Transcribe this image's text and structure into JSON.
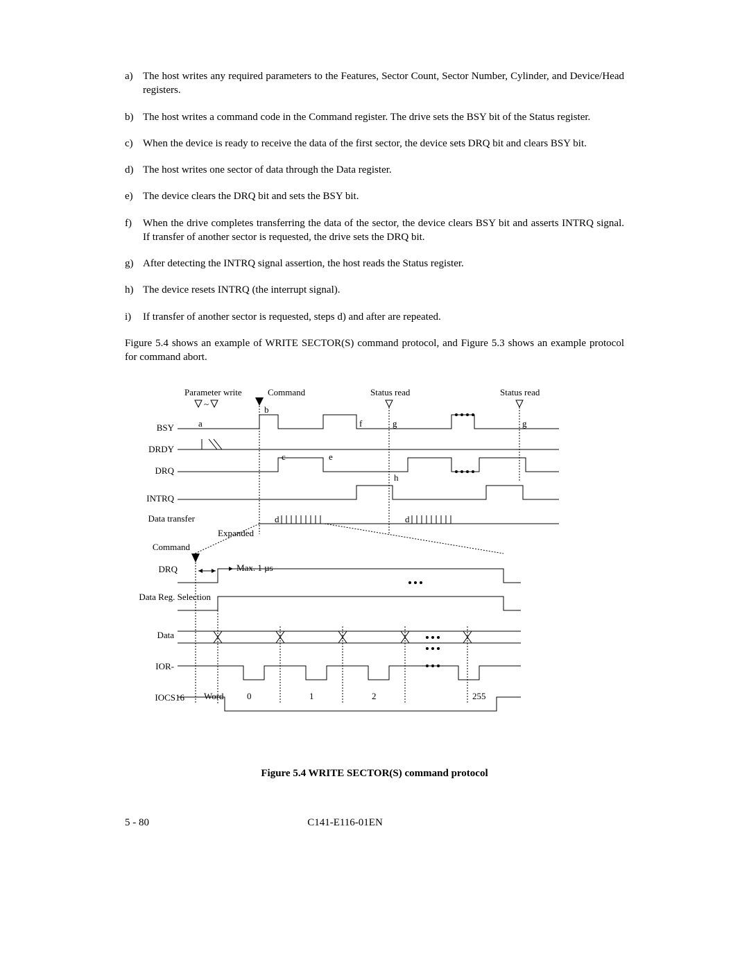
{
  "items": [
    {
      "m": "a)",
      "t": "The host writes any required parameters to the Features, Sector Count, Sector Number, Cylinder, and Device/Head registers."
    },
    {
      "m": "b)",
      "t": "The host writes a command code in the Command register. The drive sets the BSY bit of the Status register."
    },
    {
      "m": "c)",
      "t": "When the device is ready to receive the data of the first sector, the device sets DRQ bit and clears BSY bit."
    },
    {
      "m": "d)",
      "t": "The host writes one sector of data through the Data register."
    },
    {
      "m": "e)",
      "t": "The device clears the DRQ bit and sets the BSY bit."
    },
    {
      "m": "f)",
      "t": "When the drive completes transferring the data of the sector, the device clears BSY bit and asserts INTRQ signal.  If transfer of another sector is requested, the drive sets the DRQ bit."
    },
    {
      "m": "g)",
      "t": "After detecting the INTRQ signal assertion, the host reads the Status register."
    },
    {
      "m": "h)",
      "t": "The device resets INTRQ (the interrupt signal)."
    },
    {
      "m": "i)",
      "t": "If transfer of another sector is requested, steps d) and after are repeated."
    }
  ],
  "para": "Figure 5.4 shows an example of WRITE SECTOR(S) command protocol, and Figure 5.3 shows an example protocol for command abort.",
  "fig": {
    "top_labels": {
      "param": "Parameter write",
      "cmd": "Command",
      "sr1": "Status read",
      "sr2": "Status read"
    },
    "signals": [
      "BSY",
      "DRDY",
      "DRQ",
      "INTRQ",
      "Data transfer",
      "Command",
      "DRQ",
      "Data Reg. Selection",
      "Data",
      "IOR-",
      "IOCS16"
    ],
    "notes": {
      "expanded": "Expanded",
      "max": "Max. 1 µs",
      "word": "Word"
    },
    "letters": {
      "a": "a",
      "b": "b",
      "c": "c",
      "d": "d",
      "e": "e",
      "f": "f",
      "g": "g",
      "h": "h"
    },
    "word_nums": [
      "0",
      "1",
      "2",
      "255"
    ]
  },
  "caption": "Figure 5.4    WRITE SECTOR(S) command protocol",
  "footer": {
    "left": "5 - 80",
    "center": "C141-E116-01EN"
  }
}
